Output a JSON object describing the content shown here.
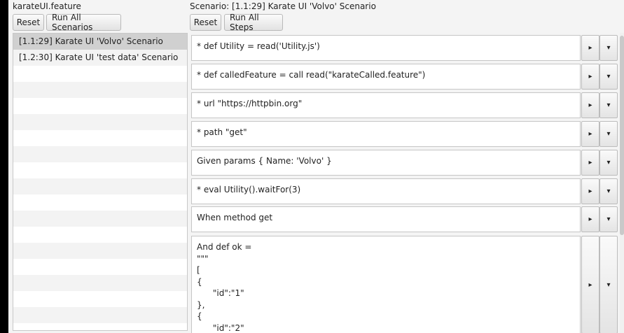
{
  "left": {
    "title": "karateUI.feature",
    "reset_label": "Reset",
    "run_all_label": "Run All Scenarios",
    "scenarios": [
      "[1.1:29] Karate UI 'Volvo' Scenario",
      "[1.2:30] Karate UI 'test data' Scenario"
    ],
    "selected_index": 0
  },
  "right": {
    "title": "Scenario: [1.1:29] Karate UI 'Volvo' Scenario",
    "reset_label": "Reset",
    "run_all_label": "Run All Steps",
    "run_icon": "play-step-icon",
    "run_glyph": "▸",
    "menu_icon": "chevron-down-icon",
    "menu_glyph": "▾",
    "steps": [
      "* def Utility = read('Utility.js')",
      "* def calledFeature = call read(\"karateCalled.feature\")",
      "* url \"https://httpbin.org\"",
      "* path \"get\"",
      "Given params { Name: 'Volvo' }",
      "* eval Utility().waitFor(3)",
      "When method get",
      "And def ok =\n\"\"\"\n[\n{\n      \"id\":\"1\"\n},\n{\n      \"id\":\"2\""
    ]
  }
}
